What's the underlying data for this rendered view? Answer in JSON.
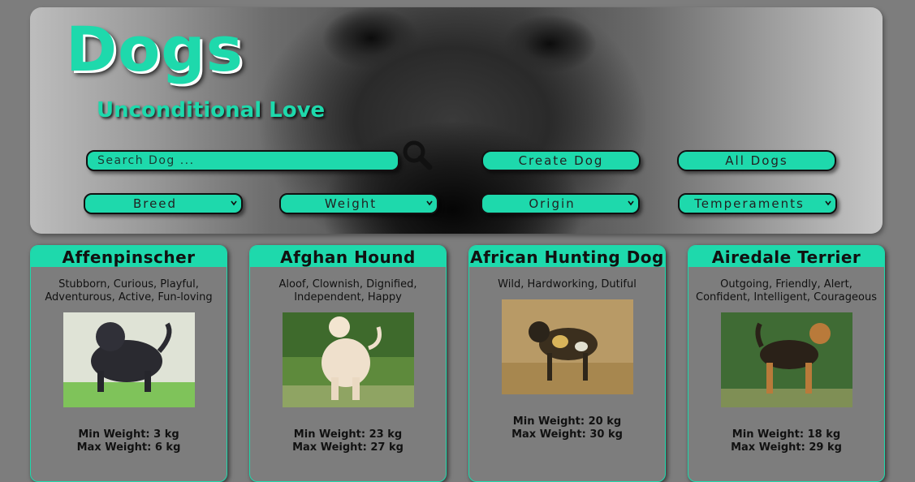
{
  "header": {
    "title": "Dogs",
    "subtitle": "Unconditional Love",
    "search_placeholder": "Search Dog ...",
    "create_label": "Create Dog",
    "all_label": "All Dogs",
    "accent_color": "#1ed9ac"
  },
  "filters": {
    "breed": "Breed",
    "weight": "Weight",
    "origin": "Origin",
    "temperaments": "Temperaments"
  },
  "cards": [
    {
      "name": "Affenpinscher",
      "temperament": "Stubborn, Curious, Playful, Adventurous, Active, Fun-loving",
      "min_weight": "Min Weight: 3 kg",
      "max_weight": "Max Weight: 6 kg"
    },
    {
      "name": "Afghan Hound",
      "temperament": "Aloof, Clownish, Dignified, Independent, Happy",
      "min_weight": "Min Weight: 23 kg",
      "max_weight": "Max Weight: 27 kg"
    },
    {
      "name": "African Hunting Dog",
      "temperament": "Wild, Hardworking, Dutiful",
      "min_weight": "Min Weight: 20 kg",
      "max_weight": "Max Weight: 30 kg"
    },
    {
      "name": "Airedale Terrier",
      "temperament": "Outgoing, Friendly, Alert, Confident, Intelligent, Courageous",
      "min_weight": "Min Weight: 18 kg",
      "max_weight": "Max Weight: 29 kg"
    }
  ]
}
